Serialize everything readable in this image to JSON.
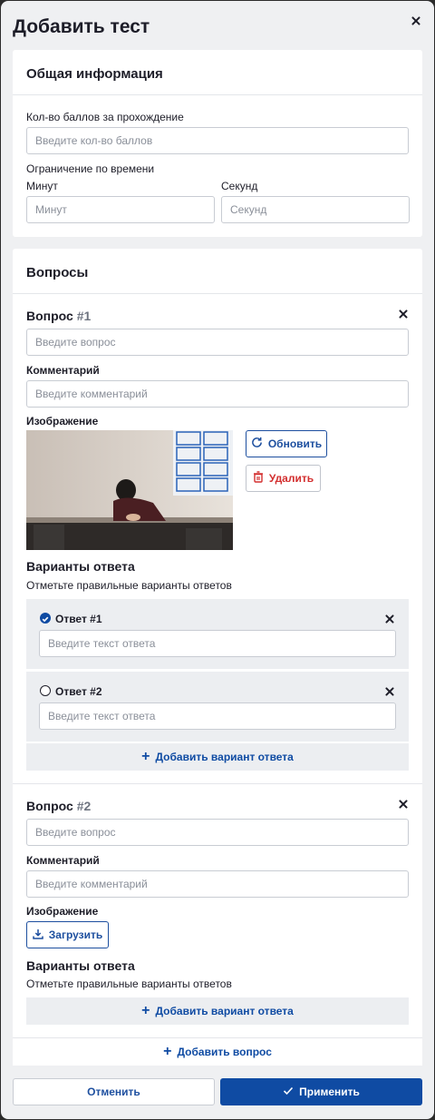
{
  "dialog": {
    "title": "Добавить тест"
  },
  "general": {
    "title": "Общая информация",
    "points_label": "Кол-во баллов за прохождение",
    "points_placeholder": "Введите кол-во баллов",
    "time_label": "Ограничение по времени",
    "minutes_label": "Минут",
    "minutes_placeholder": "Минут",
    "seconds_label": "Секунд",
    "seconds_placeholder": "Секунд"
  },
  "questions": {
    "title": "Вопросы",
    "add_question": "Добавить вопрос",
    "items": [
      {
        "title": "Вопрос",
        "number": "#1",
        "question_placeholder": "Введите вопрос",
        "comment_label": "Комментарий",
        "comment_placeholder": "Введите комментарий",
        "image_label": "Изображение",
        "refresh_label": "Обновить",
        "delete_label": "Удалить",
        "answers_title": "Варианты ответа",
        "answers_hint": "Отметьте правильные варианты ответов",
        "add_answer": "Добавить вариант ответа",
        "answers": [
          {
            "label": "Ответ #1",
            "placeholder": "Введите текст ответа",
            "checked": true
          },
          {
            "label": "Ответ #2",
            "placeholder": "Введите текст ответа",
            "checked": false
          }
        ]
      },
      {
        "title": "Вопрос",
        "number": "#2",
        "question_placeholder": "Введите вопрос",
        "comment_label": "Комментарий",
        "comment_placeholder": "Введите комментарий",
        "image_label": "Изображение",
        "upload_label": "Загрузить",
        "answers_title": "Варианты ответа",
        "answers_hint": "Отметьте правильные варианты ответов",
        "add_answer": "Добавить вариант ответа"
      }
    ]
  },
  "footer": {
    "cancel_label": "Отменить",
    "apply_label": "Применить"
  },
  "colors": {
    "primary": "#0f4ba3",
    "danger": "#d32f2f",
    "background": "#eff0f2"
  }
}
